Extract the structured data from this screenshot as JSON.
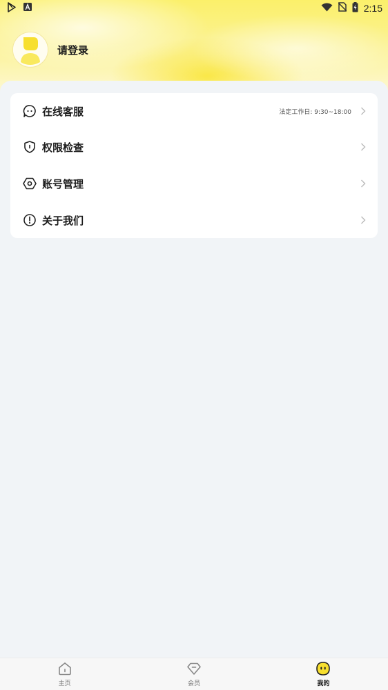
{
  "status_bar": {
    "time": "2:15",
    "left_icons": [
      "play-store-icon",
      "font-a-icon"
    ],
    "right_icons": [
      "wifi-icon",
      "no-sim-icon",
      "battery-charging-icon"
    ]
  },
  "profile": {
    "login_text": "请登录",
    "avatar_icon": "user-avatar-icon"
  },
  "menu": {
    "items": [
      {
        "label": "在线客服",
        "icon": "chat-bubble-icon",
        "note": "法定工作日: 9:30~18:00"
      },
      {
        "label": "权限检查",
        "icon": "shield-icon"
      },
      {
        "label": "账号管理",
        "icon": "hexagon-settings-icon"
      },
      {
        "label": "关于我们",
        "icon": "info-exclamation-icon"
      }
    ]
  },
  "tabbar": {
    "tabs": [
      {
        "label": "主页",
        "icon": "home-icon",
        "active": false
      },
      {
        "label": "会员",
        "icon": "diamond-icon",
        "active": false
      },
      {
        "label": "我的",
        "icon": "mine-face-icon",
        "active": true
      }
    ]
  },
  "colors": {
    "accent_yellow": "#f7df2f",
    "page_bg": "#f1f4f7",
    "card_bg": "#ffffff",
    "text_primary": "#1d1d1d"
  }
}
